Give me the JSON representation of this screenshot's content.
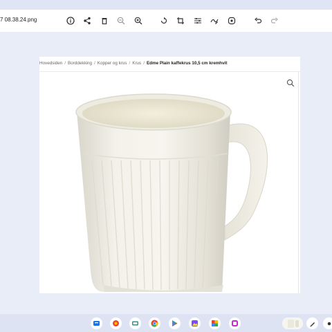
{
  "viewer": {
    "filename": "7 08.38.24.png",
    "toolbar_icons": [
      "info-icon",
      "share-icon",
      "delete-icon",
      "zoom-out-icon",
      "zoom-in-icon",
      "rotate-icon",
      "crop-icon",
      "adjust-icon",
      "markup-icon",
      "lens-icon",
      "undo-icon",
      "redo-icon"
    ]
  },
  "page": {
    "breadcrumb": [
      "Hovedsiden",
      "Borddekking",
      "Kopper og krus",
      "Krus"
    ],
    "breadcrumb_separator": "/",
    "product_title": "Edme Plain kaffekrus 10,5 cm kremhvit",
    "image_zoom_icon": "search-icon"
  },
  "shelf": {
    "apps": [
      "files-icon",
      "photos-icon",
      "meet-icon",
      "chrome-icon",
      "play-store-icon",
      "gallery-icon",
      "slides-icon",
      "media-app-icon"
    ],
    "tray": [
      "stylus-icon",
      "menu-icon"
    ]
  },
  "colors": {
    "background": "#e9edf8",
    "mug_cream": "#f1efe6",
    "accent_blue": "#1a73e8"
  }
}
